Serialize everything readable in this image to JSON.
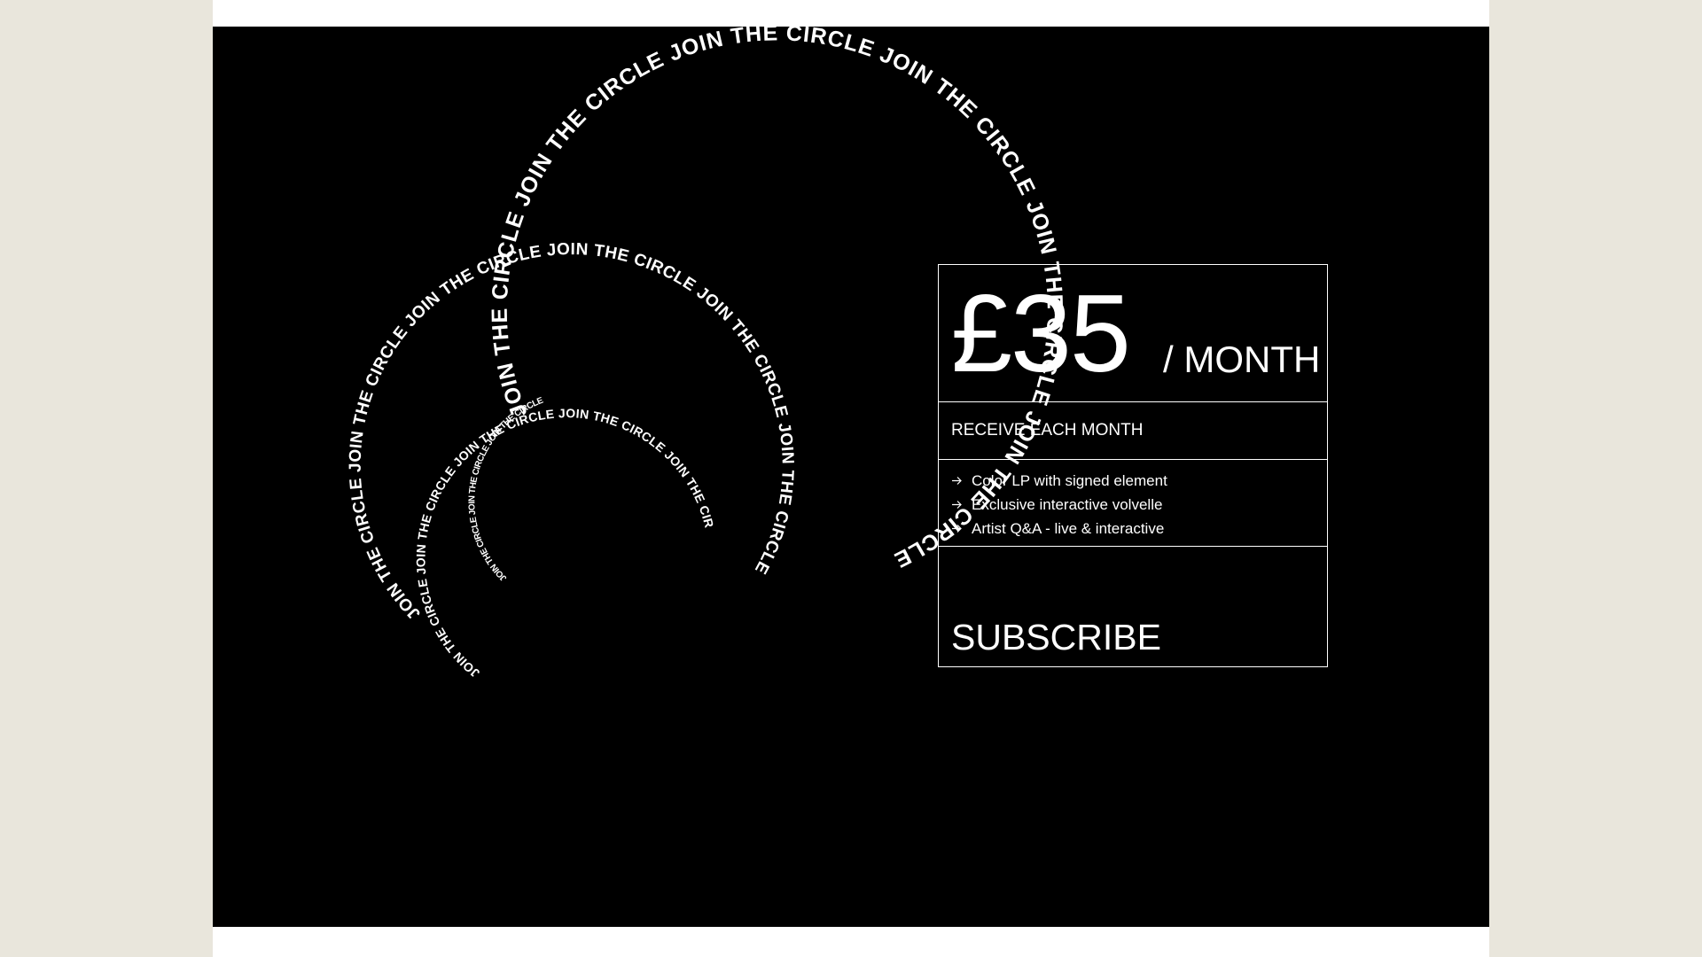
{
  "colors": {
    "background_outer": "#e9e6dc",
    "page": "#ffffff",
    "artboard": "#000000",
    "foreground": "#ffffff"
  },
  "spiral": {
    "phrase": "JOIN THE CIRCLE",
    "rings": [
      "JOIN THE CIRCLE JOIN THE CIRCLE JOIN THE CIRCLE JOIN THE CIRCLE JOIN THE CIRCLE JOIN THE CIRCLE",
      "JOIN THE CIRCLE JOIN THE CIRCLE JOIN THE CIRCLE JOIN THE CIRCLE JOIN THE CIRCLE JOIN THE CIRCLE",
      "JOIN THE CIRCLE JOIN THE CIRCLE JOIN THE CIRCLE JOIN THE CIRCLE JOIN THE CIRCLE",
      "JOIN THE CIRCLE JOIN THE CIRCLE JOIN THE CIRCLE"
    ]
  },
  "pricing": {
    "amount": "£35",
    "period": "/ MONTH",
    "receive_title": "RECEIVE EACH MONTH",
    "benefits": [
      "Color LP with signed element",
      "Exclusive interactive volvelle",
      "Artist Q&A - live & interactive"
    ],
    "arrow_icon": "arrow-right-icon",
    "subscribe_label": "SUBSCRIBE"
  }
}
